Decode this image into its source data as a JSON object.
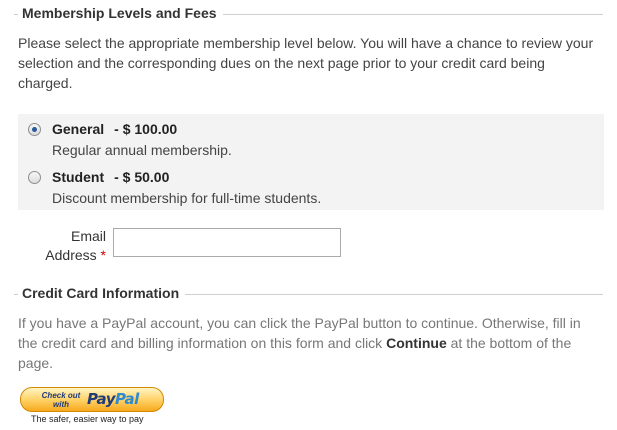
{
  "membership": {
    "legend": "Membership Levels and Fees",
    "intro": "Please select the appropriate membership level below. You will have a chance to review your selection and the corresponding dues on the next page prior to your credit card being charged.",
    "options": [
      {
        "title": "General",
        "price": "- $ 100.00",
        "description": "Regular annual membership.",
        "selected": true
      },
      {
        "title": "Student",
        "price": "- $ 50.00",
        "description": "Discount membership for full-time students.",
        "selected": false
      }
    ],
    "email_label": "Email Address",
    "email_required_mark": "*",
    "email_value": ""
  },
  "credit_card": {
    "legend": "Credit Card Information",
    "intro_prefix": "If you have a PayPal account, you can click the PayPal button to continue. Otherwise, fill in the credit card and billing information on this form and click ",
    "intro_bold": "Continue",
    "intro_suffix": " at the bottom of the page."
  },
  "paypal_button": {
    "line1": "Check out",
    "line2": "with",
    "logo_pay": "Pay",
    "logo_pal": "Pal",
    "tagline": "The safer, easier way to pay",
    "colors": {
      "fill": "#ffc439",
      "text": "#1f3b78",
      "accent": "#2b8ad0"
    }
  }
}
